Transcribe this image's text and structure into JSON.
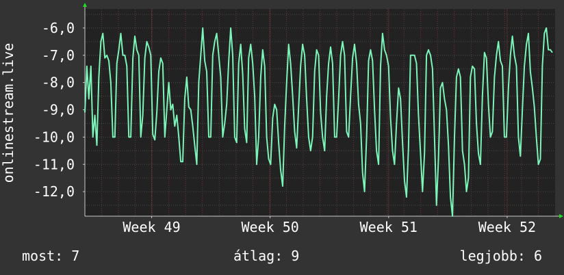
{
  "chart_data": {
    "type": "line",
    "ylabel": "onlinestream.live",
    "yticks": [
      "-6,0",
      "-7,0",
      "-8,0",
      "-9,0",
      "-10,0",
      "-11,0",
      "-12,0"
    ],
    "ytick_values": [
      -6,
      -7,
      -8,
      -9,
      -10,
      -11,
      -12
    ],
    "ylim": [
      -12.9,
      -5.3
    ],
    "xticks": [
      "Week 49",
      "Week 50",
      "Week 51",
      "Week 52"
    ],
    "xtick_positions": [
      0.142,
      0.394,
      0.646,
      0.898
    ],
    "xlim": [
      0,
      1
    ],
    "grid": true,
    "line_color": "#7cf5b9",
    "background_color": "#222222",
    "grid_color": "#4a4a4a",
    "minor_grid_color": "#6a3a3a",
    "series": [
      {
        "values": [
          -9.1,
          -7.4,
          -8.6,
          -7.4,
          -10.0,
          -9.2,
          -10.3,
          -7.8,
          -6.5,
          -6.2,
          -7.1,
          -7.0,
          -7.2,
          -8.0,
          -10.0,
          -10.0,
          -7.3,
          -6.8,
          -6.2,
          -7.0,
          -7.0,
          -7.4,
          -10.0,
          -10.0,
          -7.1,
          -6.3,
          -6.8,
          -7.0,
          -10.0,
          -9.2,
          -7.1,
          -6.5,
          -6.7,
          -7.0,
          -9.9,
          -10.1,
          -9.1,
          -7.6,
          -7.1,
          -7.3,
          -10.0,
          -9.0,
          -8.0,
          -9.0,
          -8.8,
          -9.6,
          -9.2,
          -10.0,
          -10.9,
          -10.9,
          -8.6,
          -7.8,
          -8.9,
          -9.0,
          -9.6,
          -10.3,
          -11.0,
          -8.0,
          -7.0,
          -6.0,
          -7.2,
          -7.6,
          -10.0,
          -10.0,
          -7.0,
          -6.5,
          -6.2,
          -7.0,
          -7.8,
          -10.0,
          -9.5,
          -8.8,
          -7.2,
          -6.0,
          -7.0,
          -10.0,
          -10.2,
          -7.3,
          -6.6,
          -7.7,
          -9.7,
          -10.2,
          -7.1,
          -6.6,
          -7.3,
          -8.5,
          -11.0,
          -10.0,
          -7.8,
          -6.8,
          -7.4,
          -10.0,
          -10.8,
          -11.0,
          -9.3,
          -8.8,
          -9.0,
          -10.2,
          -11.2,
          -11.8,
          -9.6,
          -8.0,
          -6.6,
          -7.3,
          -8.5,
          -9.8,
          -10.4,
          -8.9,
          -7.4,
          -6.6,
          -7.0,
          -8.6,
          -10.0,
          -10.5,
          -10.0,
          -7.6,
          -6.8,
          -7.0,
          -9.1,
          -10.0,
          -10.5,
          -8.5,
          -7.3,
          -6.7,
          -7.3,
          -10.0,
          -10.0,
          -8.6,
          -7.0,
          -6.5,
          -7.0,
          -9.8,
          -10.0,
          -8.5,
          -7.1,
          -6.6,
          -7.3,
          -8.8,
          -9.5,
          -11.3,
          -12.0,
          -10.0,
          -7.2,
          -6.8,
          -7.2,
          -9.0,
          -10.5,
          -11.0,
          -7.4,
          -6.2,
          -6.8,
          -7.0,
          -7.4,
          -9.3,
          -10.5,
          -11.0,
          -9.5,
          -8.2,
          -8.6,
          -10.2,
          -11.6,
          -12.2,
          -10.4,
          -7.0,
          -7.0,
          -7.0,
          -7.3,
          -9.2,
          -10.6,
          -12.0,
          -10.6,
          -7.0,
          -6.8,
          -7.0,
          -7.5,
          -10.0,
          -12.5,
          -10.8,
          -8.2,
          -8.0,
          -8.6,
          -9.0,
          -10.3,
          -12.2,
          -12.9,
          -10.0,
          -7.8,
          -7.5,
          -7.8,
          -10.5,
          -11.0,
          -12.0,
          -11.5,
          -7.8,
          -7.4,
          -7.5,
          -9.5,
          -10.6,
          -11.0,
          -8.5,
          -6.9,
          -7.1,
          -8.8,
          -10.0,
          -9.8,
          -7.8,
          -7.0,
          -6.5,
          -7.2,
          -7.4,
          -10.0,
          -10.0,
          -8.2,
          -7.0,
          -6.3,
          -7.0,
          -7.4,
          -10.0,
          -10.7,
          -9.0,
          -7.4,
          -6.6,
          -6.2,
          -7.6,
          -8.2,
          -8.9,
          -10.0,
          -11.0,
          -10.8,
          -7.4,
          -6.2,
          -6.0,
          -6.8,
          -6.8,
          -6.9
        ]
      }
    ]
  },
  "stats": {
    "current": "most: 7",
    "average": "átlag: 9",
    "best": "legjobb: 6"
  }
}
